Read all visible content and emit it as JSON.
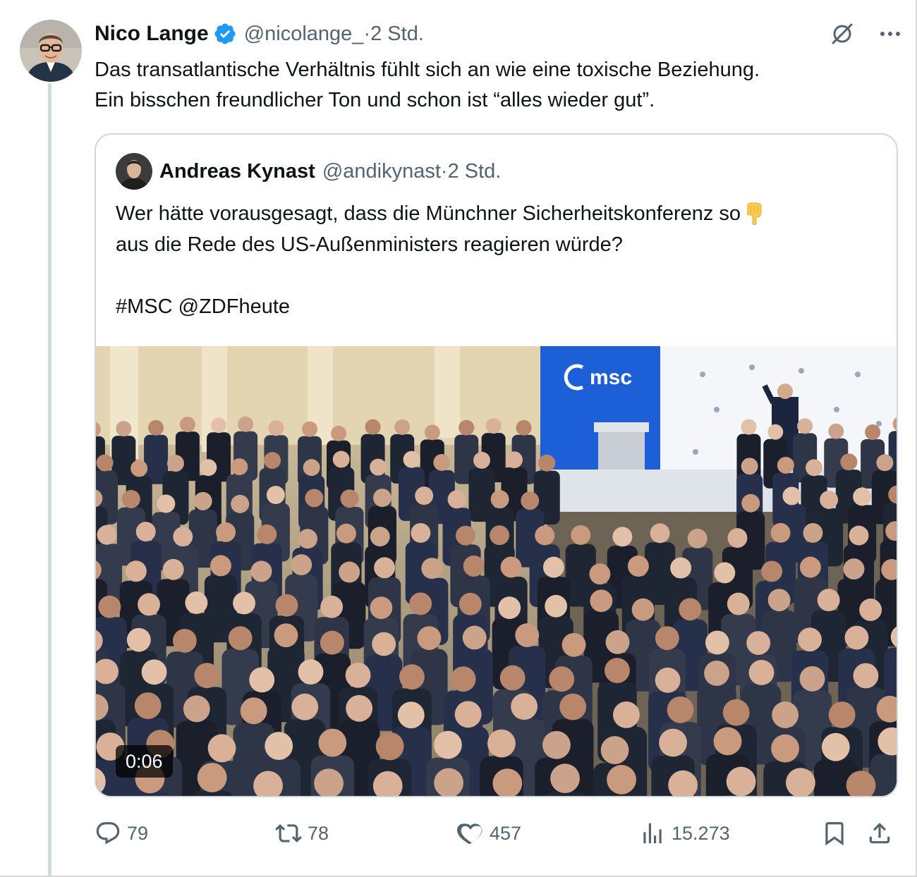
{
  "tweet": {
    "author_name": "Nico Lange",
    "author_handle": "@nicolange_",
    "separator": "·",
    "time": "2 Std.",
    "text_line1": "Das transatlantische Verhältnis fühlt sich an wie eine toxische Beziehung.",
    "text_line2": "Ein bisschen freundlicher Ton und schon ist “alles wieder gut”."
  },
  "quote": {
    "author_name": "Andreas Kynast",
    "author_handle": "@andikynast",
    "separator": "·",
    "time": "2 Std.",
    "line1": "Wer hätte vorausgesagt, dass die Münchner Sicherheitskonferenz so",
    "line2": "aus die Rede des US-Außenministers reagieren würde?",
    "line3": "#MSC @ZDFheute",
    "video_duration": "0:06",
    "video_logo_text": "msc"
  },
  "actions": {
    "replies": "79",
    "reposts": "78",
    "likes": "457",
    "views": "15.273"
  },
  "icons": {
    "verified": "verified-badge-icon",
    "grok": "grok-icon",
    "more": "more-icon",
    "reply": "reply-icon",
    "repost": "repost-icon",
    "like": "like-icon",
    "views": "views-icon",
    "bookmark": "bookmark-icon",
    "share": "share-icon",
    "emoji": "pointing-down-emoji"
  },
  "colors": {
    "verified": "#1d9bf0",
    "text": "#0f1419",
    "muted": "#536471",
    "border": "#cfd9de",
    "msc_blue": "#1c5fd6"
  }
}
